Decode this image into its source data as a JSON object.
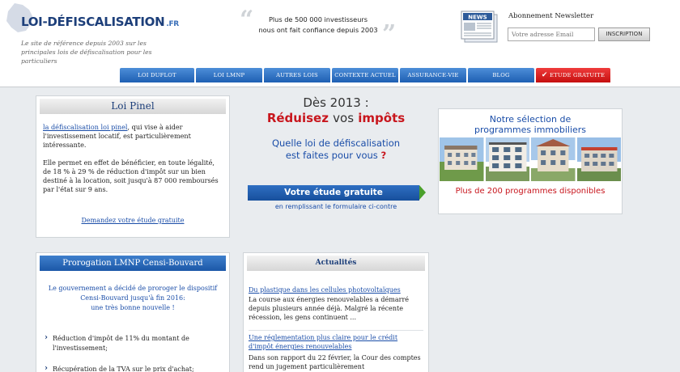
{
  "header": {
    "logo": {
      "name": "LOI-DÉFISCALISATION",
      "tld": ".FR"
    },
    "tagline": "Le site de référence depuis 2003 sur les principales lois de défiscalisation pour les particuliers",
    "quote": {
      "line1": "Plus de 500 000 investisseurs",
      "line2": "nous ont fait confiance depuis 2003"
    },
    "newsletter": {
      "icon_label": "NEWS",
      "title": "Abonnement Newsletter",
      "placeholder": "Votre adresse Email",
      "button": "INSCRIPTION"
    }
  },
  "nav": {
    "tabs": [
      {
        "label": "LOI DUFLOT"
      },
      {
        "label": "LOI LMNP"
      },
      {
        "label": "AUTRES LOIS"
      },
      {
        "label": "CONTEXTE ACTUEL"
      },
      {
        "label": "ASSURANCE-VIE"
      },
      {
        "label": "BLOG"
      },
      {
        "label": "ETUDE GRATUITE"
      }
    ]
  },
  "pinel": {
    "title": "Loi Pinel",
    "link": "la défiscalisation loi pinel",
    "text1": ", qui vise à aider l'investissement locatif, est particulièrement intéressante.",
    "text2": "Elle permet en effet de bénéficier, en toute légalité, de 18 % à 29 % de réduction d'impôt sur un bien destiné à la location, soit jusqu'à 87 000   remboursés par l'état sur 9 ans.",
    "cta": "Demandez votre étude gratuite"
  },
  "promo": {
    "year": "Dès 2013 :",
    "headline_a": "Réduisez ",
    "headline_b": "vos",
    "headline_c": " impôts",
    "question_a": "Quelle loi de défiscalisation",
    "question_b": "est faites pour vous ",
    "question_mark": "?",
    "button": "Votre étude gratuite",
    "sub": "en remplissant le formulaire ci-contre"
  },
  "programmes": {
    "title_line1": "Notre sélection de",
    "title_line2": "programmes immobiliers",
    "count": "Plus de 200 programmes disponibles"
  },
  "lmnp": {
    "title": "Prorogation LMNP Censi-Bouvard",
    "intro_line1": "Le gouvernement a décidé de proroger le dispositif",
    "intro_line2": "Censi-Bouvard jusqu'à fin 2016:",
    "intro_line3": "une très bonne nouvelle !",
    "bullets": [
      {
        "text": "Réduction d'impôt de 11% du montant de l'investissement;"
      },
      {
        "text": "Récupération de la TVA sur le prix d'achat;"
      }
    ]
  },
  "actualites": {
    "title": "Actualités",
    "items": [
      {
        "link": "Du plastique dans les cellules photovoltaïques",
        "text": "La course aux énergies renouvelables a démarré depuis plusieurs année déjà. Malgré la récente récession, les gens continuent ..."
      },
      {
        "link": "Une réglementation plus claire pour le crédit d'impôt énergies renouvelables",
        "text": "Dans son rapport du 22 février, la Cour des comptes rend un jugement particulièrement"
      }
    ]
  },
  "colors": {
    "brand_blue": "#1d3f7a",
    "link_blue": "#1a4da8",
    "accent_red": "#c8161d",
    "cta_green": "#4aa02c"
  }
}
